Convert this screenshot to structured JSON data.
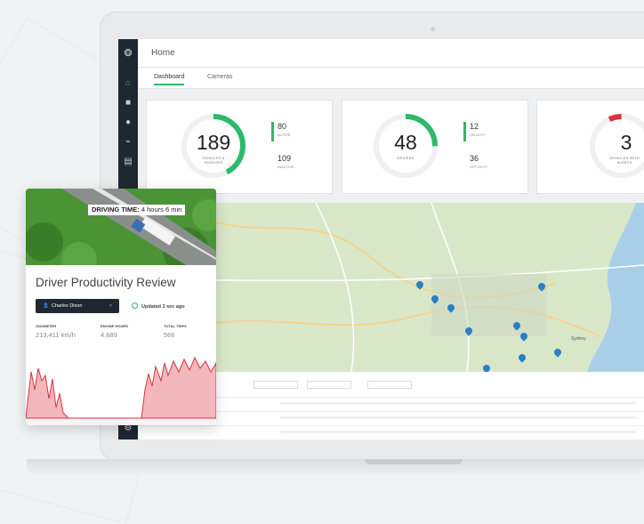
{
  "app": {
    "page_title": "Home",
    "tabs": [
      {
        "label": "Dashboard",
        "active": true
      },
      {
        "label": "Cameras",
        "active": false
      }
    ],
    "accent_color": "#2dba6a",
    "nav_icons": [
      "logo-icon",
      "home-icon",
      "vehicle-icon",
      "group-icon",
      "chart-icon",
      "document-icon",
      "settings-icon"
    ]
  },
  "cards": [
    {
      "value": "189",
      "label": "VEHICLES & SENSORS",
      "stats": [
        {
          "value": "80",
          "label": "ACTIVE"
        },
        {
          "value": "109",
          "label": "INACTIVE"
        }
      ]
    },
    {
      "value": "48",
      "label": "DRIVERS",
      "stats": [
        {
          "value": "12",
          "label": "ON DUTY"
        },
        {
          "value": "36",
          "label": "OFF DUTY"
        }
      ]
    },
    {
      "value": "3",
      "label": "VEHICLES WITH ALERTS",
      "stats": []
    }
  ],
  "map_labels": [
    "Sydney"
  ],
  "overlay": {
    "driving_time_label": "DRIVING TIME:",
    "driving_time_value": "4 hours 6 min",
    "title": "Driver Productivity Review",
    "driver_chip": "Charles Dixon",
    "updated": "Updated 3 sec ago",
    "metrics": [
      {
        "label": "ODOMETER",
        "value": "213,411 km/h"
      },
      {
        "label": "ENGINE HOURS",
        "value": "4,689"
      },
      {
        "label": "TOTAL TRIPS",
        "value": "566"
      }
    ],
    "chart_color": "#d9323c"
  }
}
